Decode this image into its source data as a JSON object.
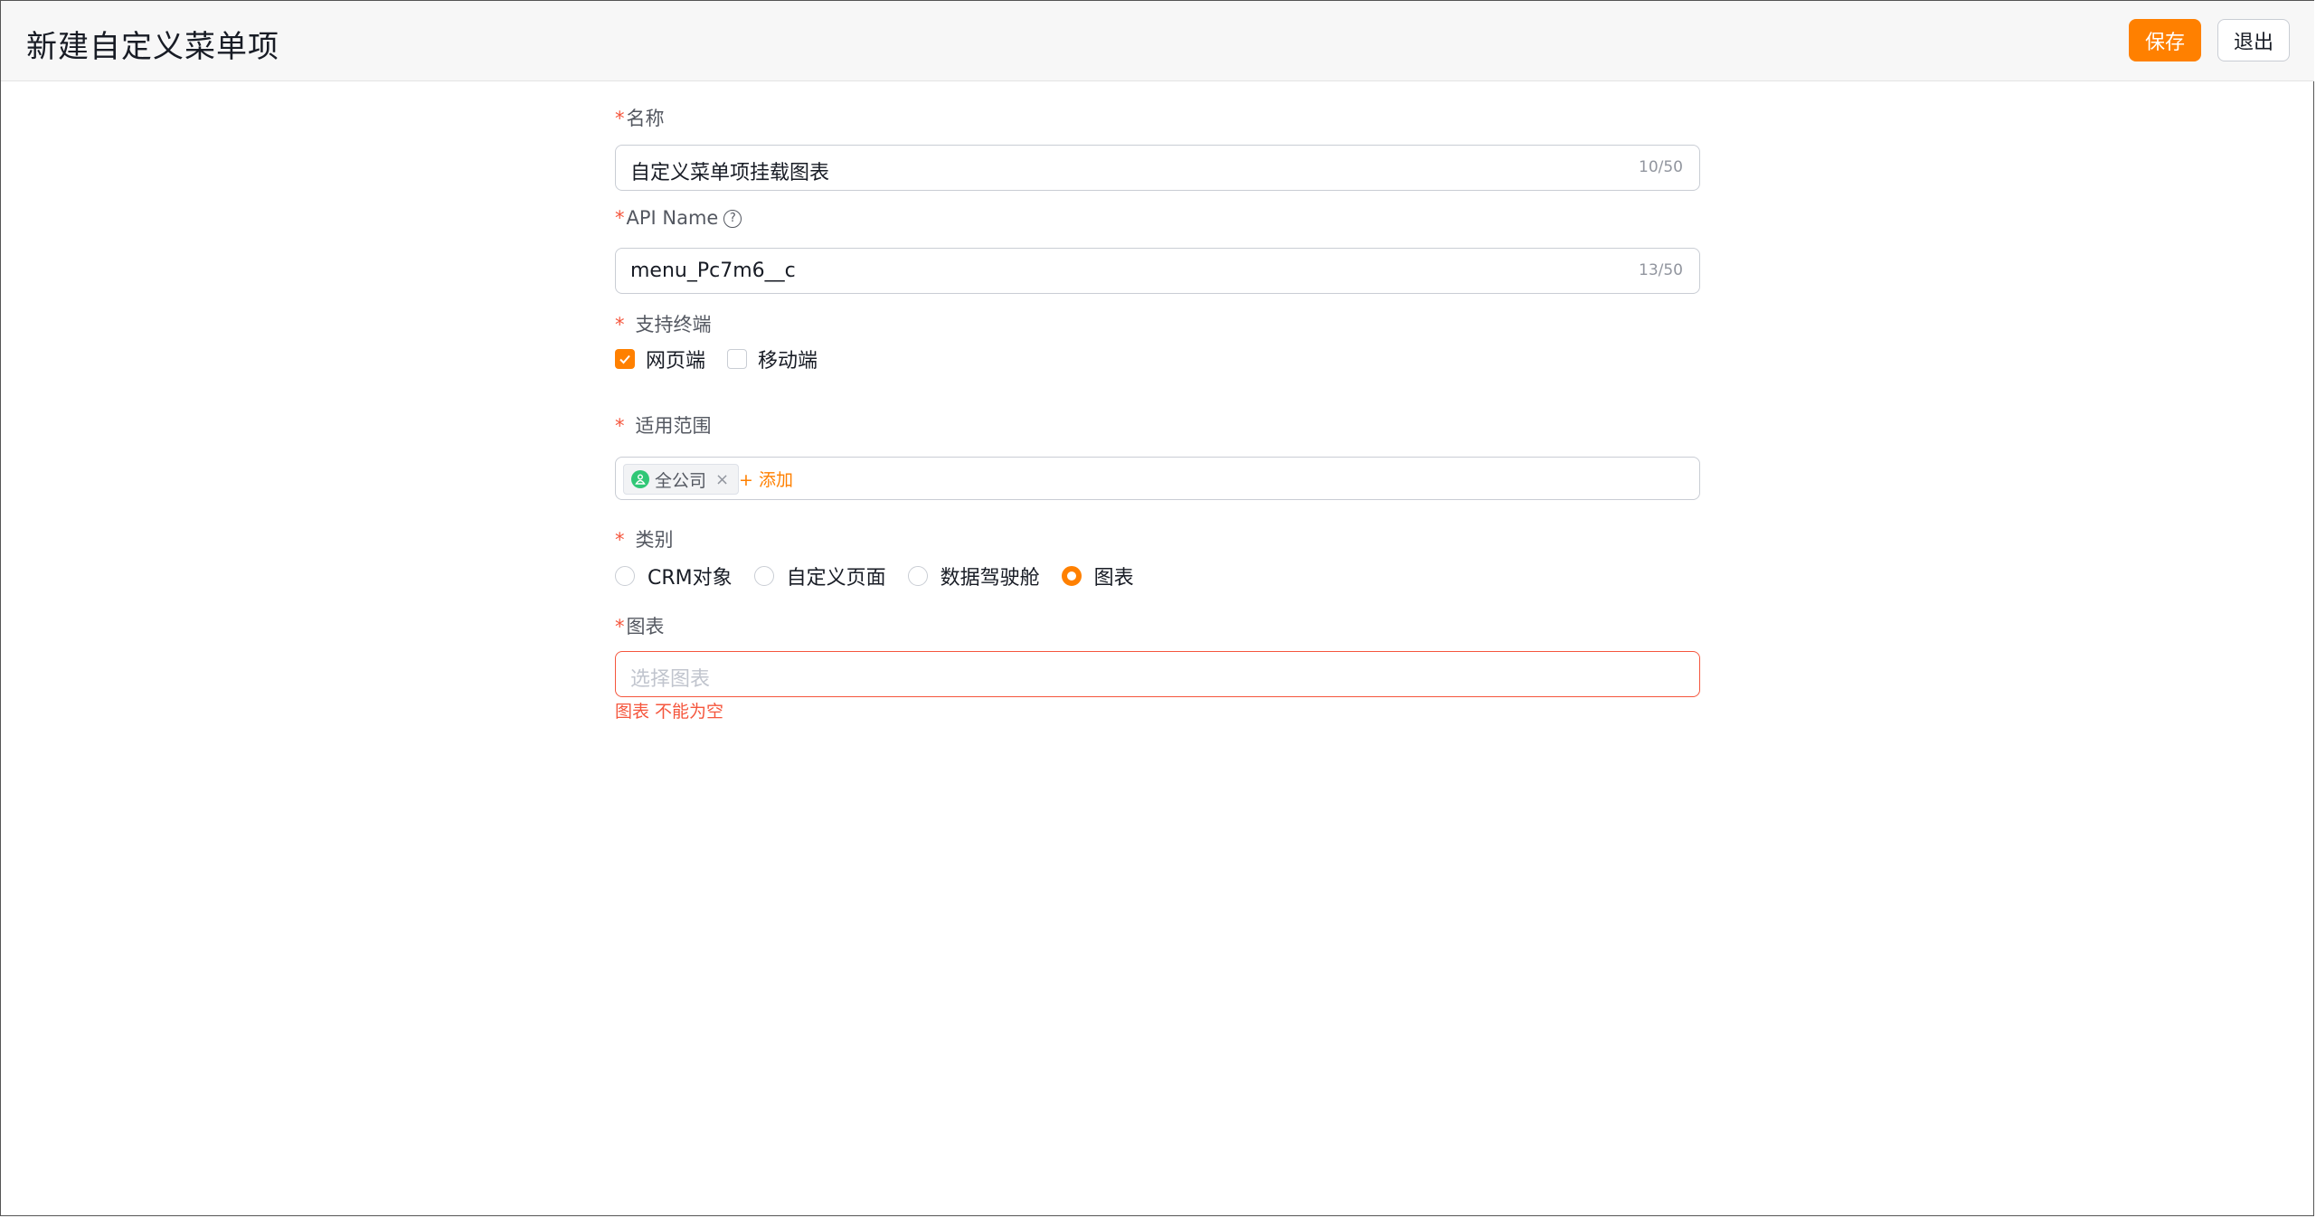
{
  "header": {
    "title": "新建自定义菜单项",
    "save_label": "保存",
    "exit_label": "退出"
  },
  "form": {
    "name": {
      "label": "名称",
      "value": "自定义菜单项挂载图表",
      "count": "10/50"
    },
    "api_name": {
      "label": "API Name",
      "value": "menu_Pc7m6__c",
      "count": "13/50",
      "help_icon": "?"
    },
    "terminals": {
      "label": "支持终端",
      "options": [
        {
          "label": "网页端",
          "checked": true
        },
        {
          "label": "移动端",
          "checked": false
        }
      ]
    },
    "scope": {
      "label": "适用范围",
      "tag": "全公司",
      "tag_close": "×",
      "add_label": "+ 添加"
    },
    "category": {
      "label": "类别",
      "options": [
        {
          "label": "CRM对象",
          "selected": false
        },
        {
          "label": "自定义页面",
          "selected": false
        },
        {
          "label": "数据驾驶舱",
          "selected": false
        },
        {
          "label": "图表",
          "selected": true
        }
      ]
    },
    "chart": {
      "label": "图表",
      "placeholder": "选择图表",
      "error": "图表 不能为空"
    }
  },
  "colors": {
    "accent": "#ff8000",
    "error": "#f5563d",
    "border": "#c9cdd4",
    "tag_icon": "#30c776"
  }
}
